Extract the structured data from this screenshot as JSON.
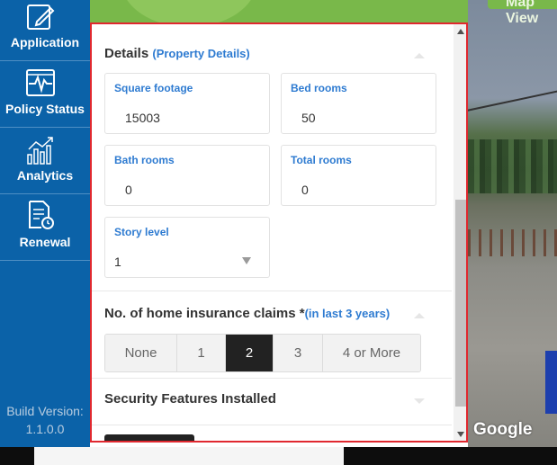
{
  "sidebar": {
    "items": [
      {
        "label": "Application",
        "icon": "edit-icon"
      },
      {
        "label": "Policy Status",
        "icon": "pulse-icon"
      },
      {
        "label": "Analytics",
        "icon": "analytics-icon"
      },
      {
        "label": "Renewal",
        "icon": "renewal-document-icon"
      }
    ],
    "build_label": "Build Version:",
    "build_version": "1.1.0.0"
  },
  "map": {
    "tab_label": "Map View",
    "google_logo": "Google"
  },
  "details": {
    "title": "Details",
    "subtitle": "(Property Details)",
    "fields": {
      "square_footage": {
        "label": "Square footage",
        "value": "15003"
      },
      "bed_rooms": {
        "label": "Bed rooms",
        "value": "50"
      },
      "bath_rooms": {
        "label": "Bath rooms",
        "value": "0"
      },
      "total_rooms": {
        "label": "Total rooms",
        "value": "0"
      },
      "story_level": {
        "label": "Story level",
        "value": "1"
      }
    }
  },
  "claims": {
    "title": "No. of home insurance claims *",
    "subtitle": "(in last 3 years)",
    "options": [
      "None",
      "1",
      "2",
      "3",
      "4 or More"
    ],
    "selected": "2"
  },
  "security": {
    "title": "Security Features Installed"
  },
  "colors": {
    "sidebar": "#0b62a8",
    "accent_blue": "#2e7bd1",
    "header_green": "#79b84a",
    "panel_border": "#e0282f",
    "selected_option": "#222222"
  }
}
